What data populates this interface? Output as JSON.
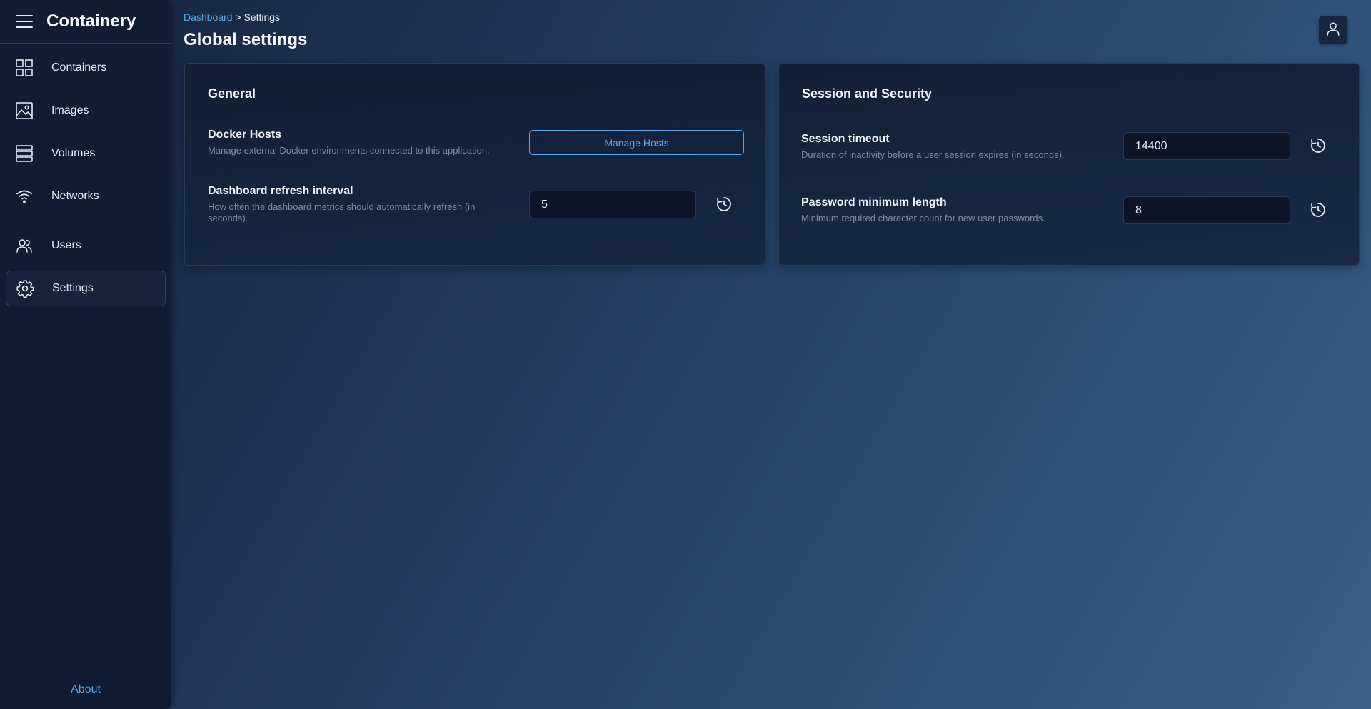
{
  "app": {
    "brand": "Containery"
  },
  "sidebar": {
    "items": [
      {
        "label": "Containers",
        "icon": "grid-icon"
      },
      {
        "label": "Images",
        "icon": "image-icon"
      },
      {
        "label": "Volumes",
        "icon": "stack-icon"
      },
      {
        "label": "Networks",
        "icon": "wifi-icon"
      },
      {
        "label": "Users",
        "icon": "users-icon"
      },
      {
        "label": "Settings",
        "icon": "gear-icon",
        "active": true
      }
    ],
    "about": "About"
  },
  "breadcrumb": {
    "root": "Dashboard",
    "separator": ">",
    "current": "Settings"
  },
  "page": {
    "title": "Global settings"
  },
  "general": {
    "title": "General",
    "docker_hosts": {
      "label": "Docker Hosts",
      "description": "Manage external Docker environments connected to this application.",
      "button": "Manage Hosts"
    },
    "refresh": {
      "label": "Dashboard refresh interval",
      "description": "How often the dashboard metrics should automatically refresh (in seconds).",
      "value": "5"
    }
  },
  "security": {
    "title": "Session and Security",
    "timeout": {
      "label": "Session timeout",
      "description": "Duration of inactivity before a user session expires (in seconds).",
      "value": "14400"
    },
    "password": {
      "label": "Password minimum length",
      "description": "Minimum required character count for new user passwords.",
      "value": "8"
    }
  },
  "colors": {
    "accent": "#5aa6e8",
    "sidebar_bg": "#0f1b31",
    "card_bg": "#111e34"
  }
}
